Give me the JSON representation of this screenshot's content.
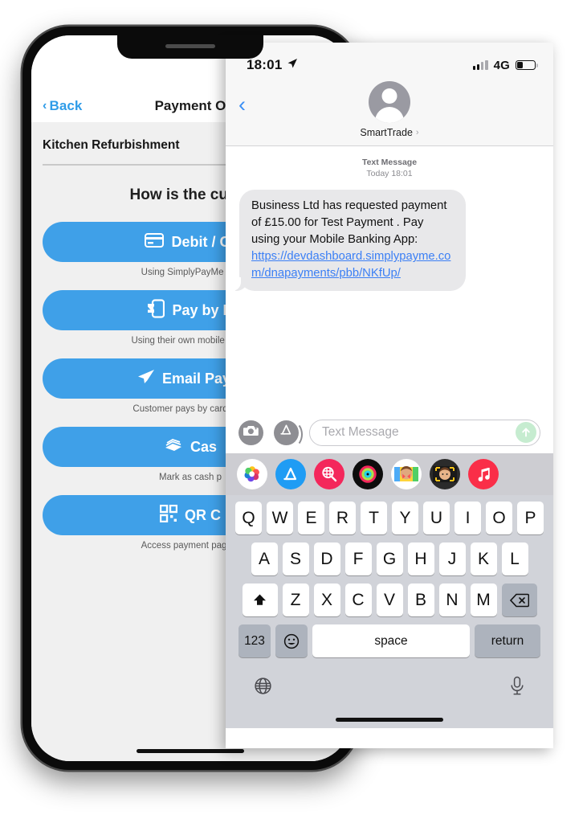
{
  "back_phone": {
    "nav": {
      "back_label": "Back",
      "back_chevron": "‹",
      "title": "Payment O"
    },
    "job_title": "Kitchen Refurbishment",
    "question": "How is the custo",
    "payment_options": [
      {
        "icon": "credit-card-icon",
        "label": "Debit / Cr",
        "subtitle": "Using SimplyPayMe her"
      },
      {
        "icon": "pay-by-bank-icon",
        "label": "Pay by B",
        "subtitle": "Using their own mobile banki"
      },
      {
        "icon": "paper-plane-icon",
        "label": "Email Paym",
        "subtitle": "Customer pays by card on c"
      },
      {
        "icon": "cash-icon",
        "label": "Cas",
        "subtitle": "Mark as cash p"
      },
      {
        "icon": "qr-code-icon",
        "label": "QR C",
        "subtitle": "Access payment page u"
      }
    ],
    "accent_color": "#3fa0e8",
    "link_color": "#2f9ce8"
  },
  "front_phone": {
    "status_bar": {
      "time": "18:01",
      "location_arrow": "➤",
      "signal_bars_total": 4,
      "signal_bars_filled": 2,
      "network": "4G",
      "battery_percent": 30
    },
    "header": {
      "back_chevron": "‹",
      "contact_name": "SmartTrade",
      "contact_chevron": "›",
      "avatar": "person-avatar"
    },
    "conversation": {
      "stamp_type": "Text Message",
      "stamp_time": "Today 18:01",
      "message": {
        "text_before_link": "Business Ltd has requested payment of £15.00 for Test Payment . Pay using your Mobile Banking App: ",
        "link_text": "https://devdashboard.simplypayme.com/dnapayments/pbb/NKfUp/",
        "bubble_color": "#e8e8ea",
        "link_color": "#3b7ff5"
      }
    },
    "input_bar": {
      "camera_icon": "camera-icon",
      "appstore_icon": "app-store-icon",
      "placeholder": "Text Message",
      "send_icon": "send-arrow-up-icon",
      "send_color": "#c6ecd0"
    },
    "app_drawer": [
      {
        "name": "photos-app-icon",
        "color": "#ffffff"
      },
      {
        "name": "app-store-app-icon",
        "color": "#1f9cf4"
      },
      {
        "name": "images-search-app-icon",
        "color": "#f4275b"
      },
      {
        "name": "activity-rings-app-icon",
        "color": "#0d0d0d"
      },
      {
        "name": "memoji-stickers-app-icon",
        "color": "#ffffff"
      },
      {
        "name": "memoji-app-icon",
        "color": "#2b2b2b"
      },
      {
        "name": "apple-music-app-icon",
        "color": "#fa2e48"
      }
    ],
    "keyboard": {
      "row1": [
        "Q",
        "W",
        "E",
        "R",
        "T",
        "Y",
        "U",
        "I",
        "O",
        "P"
      ],
      "row2": [
        "A",
        "S",
        "D",
        "F",
        "G",
        "H",
        "J",
        "K",
        "L"
      ],
      "row3": [
        "Z",
        "X",
        "C",
        "V",
        "B",
        "N",
        "M"
      ],
      "shift_icon": "shift-up-icon",
      "backspace_icon": "backspace-icon",
      "numbers_label": "123",
      "emoji_icon": "emoji-smiley-icon",
      "space_label": "space",
      "return_label": "return",
      "globe_icon": "globe-icon",
      "mic_icon": "microphone-icon"
    }
  }
}
